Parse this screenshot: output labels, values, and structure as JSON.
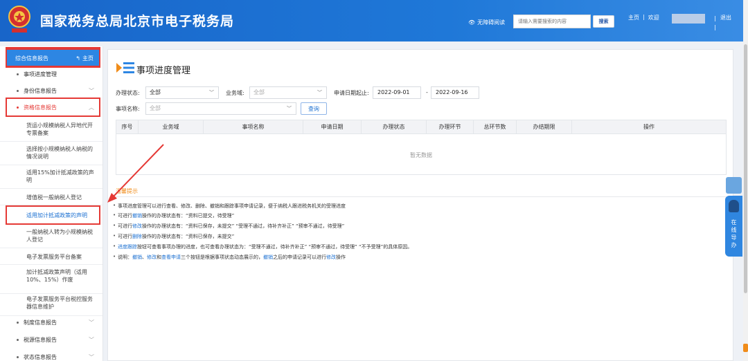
{
  "header": {
    "title": "国家税务总局北京市电子税务局",
    "accessibility_label": "无障碍阅读",
    "search_placeholder": "请输入需要搜索的内容",
    "search_button": "搜索",
    "home_link": "主页",
    "divider": "|",
    "welcome": "欢迎",
    "logout": "退出"
  },
  "sidebar": {
    "top_title": "综合信息报告",
    "top_home": "主页",
    "items": [
      {
        "label": "事项进度管理",
        "chevron": ""
      },
      {
        "label": "身份信息报告",
        "chevron": "﹀"
      },
      {
        "label": "资格信息报告",
        "chevron": "︿"
      }
    ],
    "subitems": [
      "货运小规模纳税人异地代开专票备案",
      "选择按小规模纳税人纳税的情况说明",
      "适用15%加计抵减政策的声明",
      "增值税一般纳税人登记",
      "适用加计抵减政策的声明",
      "一般纳税人转为小规模纳税人登记",
      "电子发票服务平台备案",
      "加计抵减政策声明（适用10%、15%）作废",
      "电子发票服务平台税控服务器信息维护"
    ],
    "bottom_items": [
      {
        "label": "制度信息报告",
        "chevron": "﹀"
      },
      {
        "label": "税源信息报告",
        "chevron": "﹀"
      },
      {
        "label": "状态信息报告",
        "chevron": "﹀"
      }
    ]
  },
  "main": {
    "title": "事项进度管理",
    "filters": {
      "status_label": "办理状态:",
      "status_value": "全部",
      "domain_label": "业务域:",
      "domain_value": "全部",
      "date_label": "申请日期起止:",
      "date_start": "2022-09-01",
      "date_dash": "-",
      "date_end": "2022-09-16",
      "name_label": "事项名称:",
      "name_value": "全部",
      "query_button": "查询"
    },
    "table": {
      "columns": [
        "序号",
        "业务域",
        "事项名称",
        "申请日期",
        "办理状态",
        "办理环节",
        "总环节数",
        "办结期限",
        "操作"
      ],
      "empty_text": "暂无数据"
    },
    "tips": {
      "title": "温馨提示",
      "lines": [
        [
          "事项进度管理可以进行查看、修改、删除、撤销和跟踪事项申请记录，便于纳税人跟进税务机关的受理进度"
        ],
        [
          "可进行",
          "撤销",
          "操作的办理状态有：“资料已提交，待受理”"
        ],
        [
          "可进行",
          "修改",
          "操作的办理状态有：“资料已保存，未提交” “受理不通过，待补齐补正” “预审不通过，待受理”"
        ],
        [
          "可进行",
          "删除",
          "操作的办理状态有：“资料已保存，未提交”"
        ],
        [
          "",
          "进度跟踪",
          "按钮可查看事项办理的进度，也可查看办理状态为：“受理不通过，待补齐补正” “预审不通过，待受理” “不予受理”的具体原因。"
        ]
      ],
      "last_line": {
        "p1": "说明：",
        "b1": "撤销",
        "p2": "、",
        "b2": "修改",
        "p3": "和",
        "b3": "查看申请",
        "p4": "三个按钮是根据事项状态动态展示的，",
        "b4": "撤销",
        "p5": "之后的申请记录可以进行",
        "b5": "修改",
        "p6": "操作"
      }
    }
  },
  "float_guide": {
    "text": "在线导办"
  },
  "colors": {
    "header_blue": "#1f78d8",
    "sidebar_active": "#2d86e3",
    "highlight_red": "#e53935",
    "tips_orange": "#f08c1a",
    "link_blue": "#1a6fd1"
  }
}
